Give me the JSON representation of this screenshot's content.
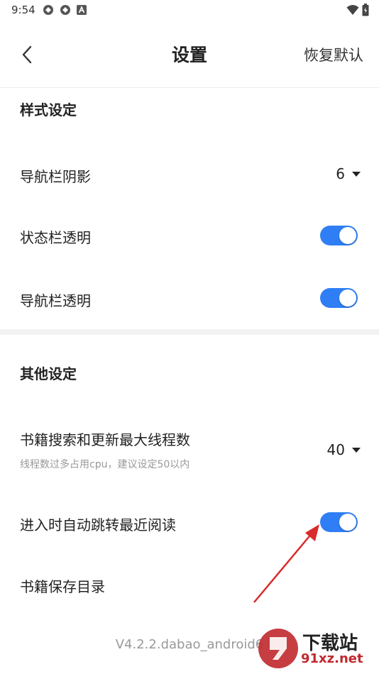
{
  "statusbar": {
    "time": "9:54"
  },
  "appbar": {
    "title": "设置",
    "restore_label": "恢复默认"
  },
  "sections": {
    "style": {
      "title": "样式设定",
      "nav_shadow": {
        "label": "导航栏阴影",
        "value": "6"
      },
      "status_transparent": {
        "label": "状态栏透明",
        "on": true
      },
      "nav_transparent": {
        "label": "导航栏透明",
        "on": true
      }
    },
    "other": {
      "title": "其他设定",
      "max_threads": {
        "label": "书籍搜索和更新最大线程数",
        "sub": "线程数过多占用cpu，建议设定50以内",
        "value": "40"
      },
      "auto_jump": {
        "label": "进入时自动跳转最近阅读",
        "on": true
      },
      "save_dir": {
        "label": "书籍保存目录"
      }
    }
  },
  "version": "V4.2.2.dabao_android6",
  "watermark": {
    "text": "下载站",
    "site": "91xz.net"
  },
  "colors": {
    "toggle_on": "#2f7ef5",
    "annotation_arrow": "#d92b2b",
    "watermark_red": "#c0282d"
  }
}
